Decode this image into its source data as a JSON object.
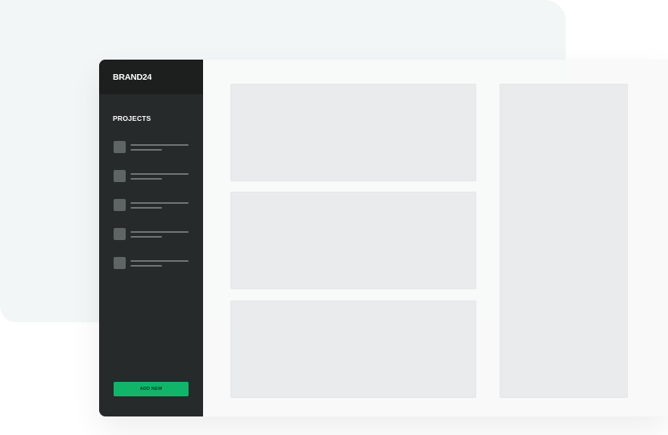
{
  "sidebar": {
    "brand": "BRAND24",
    "section_title": "PROJECTS",
    "projects": [
      {
        "thumb_icon": "project-thumbnail-icon"
      },
      {
        "thumb_icon": "project-thumbnail-icon"
      },
      {
        "thumb_icon": "project-thumbnail-icon"
      },
      {
        "thumb_icon": "project-thumbnail-icon"
      },
      {
        "thumb_icon": "project-thumbnail-icon"
      }
    ],
    "add_button_label": "ADD NEW"
  },
  "colors": {
    "sidebar_bg": "#262a2b",
    "sidebar_header_bg": "#1d1f1f",
    "accent": "#11b56a",
    "panel_bg": "#eaebec",
    "backdrop": "#f3f6f6"
  }
}
